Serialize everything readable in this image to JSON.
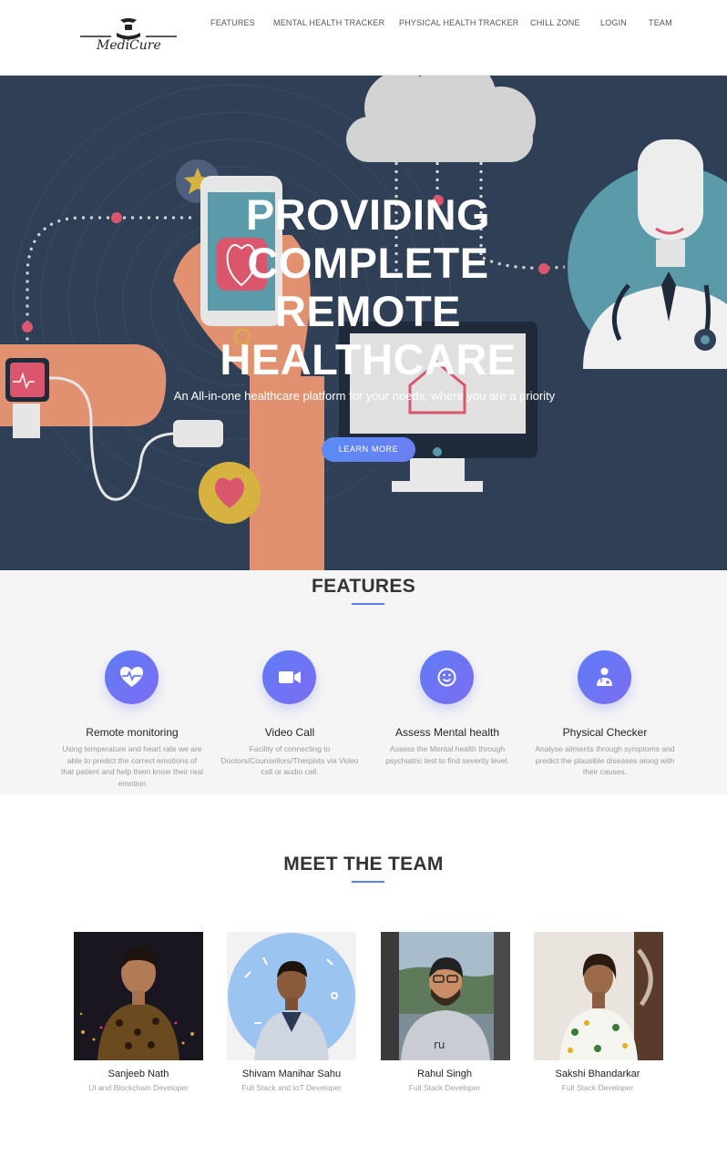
{
  "brand": {
    "name": "MediCure"
  },
  "nav": {
    "items": [
      {
        "label": "FEATURES"
      },
      {
        "label": "MENTAL HEALTH TRACKER"
      },
      {
        "label": "PHYSICAL HEALTH TRACKER"
      },
      {
        "label": "CHILL ZONE"
      },
      {
        "label": "LOGIN"
      },
      {
        "label": "TEAM"
      }
    ]
  },
  "hero": {
    "title_lines": [
      "PROVIDING",
      "COMPLETE",
      "REMOTE",
      "HEALTHCARE"
    ],
    "subtitle": "An All-in-one healthcare platform for your needs, where you are a priority",
    "cta": "LEARN MORE"
  },
  "features": {
    "title": "FEATURES",
    "items": [
      {
        "icon": "heartbeat-icon",
        "title": "Remote monitoring",
        "desc": "Using temperature and heart rate we are able to predict the correct emotions of that patient and help them know their real emotion"
      },
      {
        "icon": "video-camera-icon",
        "title": "Video Call",
        "desc": "Facility of connecting to Doctors/Counsellors/Therpists via Video call or audio call."
      },
      {
        "icon": "smiley-icon",
        "title": "Assess Mental health",
        "desc": "Assess the Mental health through psychiatric test to find severity level."
      },
      {
        "icon": "doctor-icon",
        "title": "Physical Checker",
        "desc": "Analyse ailments through symptoms and predict the plausible diseases along with their causes."
      }
    ]
  },
  "team": {
    "title": "MEET THE TEAM",
    "members": [
      {
        "name": "Sanjeeb Nath",
        "role": "UI and Blockchain Developer"
      },
      {
        "name": "Shivam Manihar Sahu",
        "role": "Full Stack and IoT Developer"
      },
      {
        "name": "Rahul Singh",
        "role": "Full Stack Developer"
      },
      {
        "name": "Sakshi Bhandarkar",
        "role": "Full Stack Developer"
      }
    ]
  },
  "colors": {
    "accent": "#5b7ef0",
    "hero_bg": "#2e3f56"
  }
}
